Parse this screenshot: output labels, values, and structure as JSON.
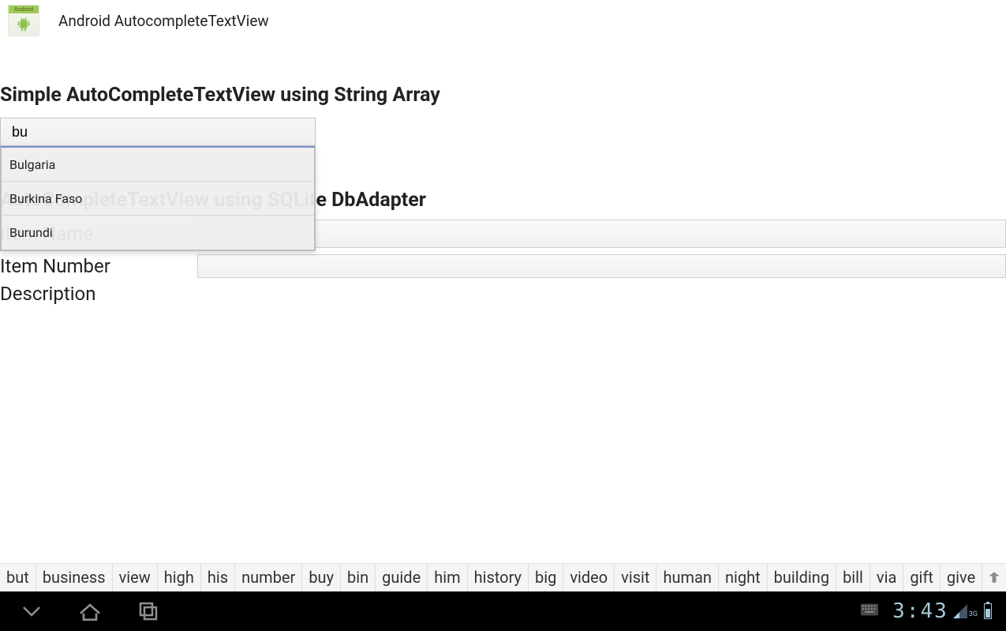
{
  "header": {
    "title": "Android AutocompleteTextView",
    "icon_banner": "Android"
  },
  "section1": {
    "heading": "Simple AutoCompleteTextView using String Array",
    "input_value": "bu",
    "suggestions": [
      "Bulgaria",
      "Burkina Faso",
      "Burundi"
    ]
  },
  "section2": {
    "heading": "AutoCompleteTextView using SQLite DbAdapter",
    "search_label": "Item Name",
    "search_placeholder": "Search Item",
    "row2_label": "Item Number",
    "row2_value": "",
    "desc_label": "Description"
  },
  "keyboard": {
    "suggestions": [
      "but",
      "business",
      "view",
      "high",
      "his",
      "number",
      "buy",
      "bin",
      "guide",
      "him",
      "history",
      "big",
      "video",
      "visit",
      "human",
      "night",
      "building",
      "bill",
      "via",
      "gift",
      "give"
    ]
  },
  "statusbar": {
    "clock": "3:43",
    "network_label": "3G"
  }
}
